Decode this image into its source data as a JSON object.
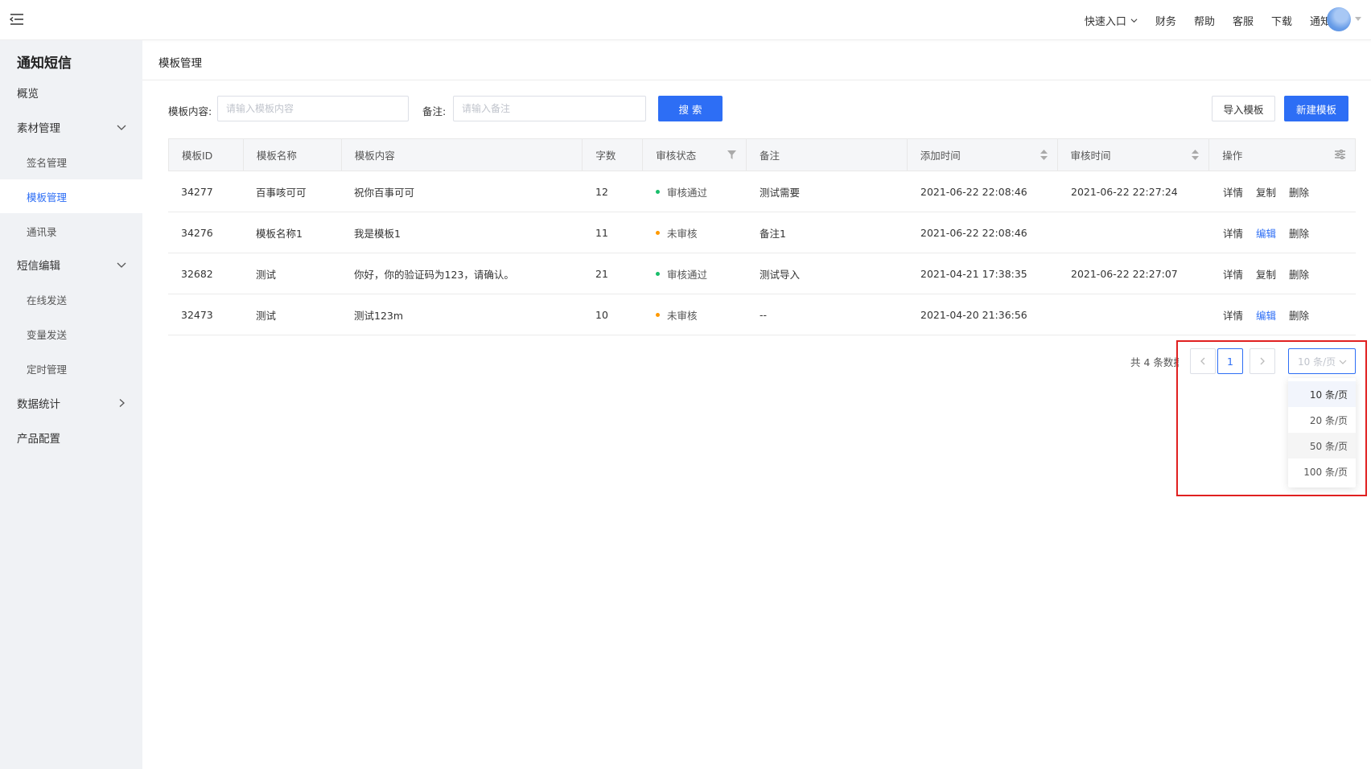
{
  "topnav": {
    "items": [
      {
        "label": "快速入口",
        "has_caret": true
      },
      {
        "label": "财务"
      },
      {
        "label": "帮助"
      },
      {
        "label": "客服"
      },
      {
        "label": "下载"
      },
      {
        "label": "通知"
      }
    ]
  },
  "sidebar": {
    "product_title": "通知短信",
    "items": [
      {
        "label": "概览",
        "level": 1
      },
      {
        "label": "素材管理",
        "level": 1,
        "arrow": "chevron-down"
      },
      {
        "label": "签名管理",
        "level": 2
      },
      {
        "label": "模板管理",
        "level": 2,
        "active": true
      },
      {
        "label": "通讯录",
        "level": 2
      },
      {
        "label": "短信编辑",
        "level": 1,
        "arrow": "chevron-down"
      },
      {
        "label": "在线发送",
        "level": 2
      },
      {
        "label": "变量发送",
        "level": 2
      },
      {
        "label": "定时管理",
        "level": 2
      },
      {
        "label": "数据统计",
        "level": 1,
        "arrow": "chevron-right"
      },
      {
        "label": "产品配置",
        "level": 1
      }
    ]
  },
  "page": {
    "breadcrumb": "模板管理"
  },
  "filters": {
    "content_label": "模板内容:",
    "content_placeholder": "请输入模板内容",
    "content_value": "",
    "remark_label": "备注:",
    "remark_placeholder": "请输入备注",
    "remark_value": "",
    "search_button": "搜 索",
    "import_button": "导入模板",
    "new_button": "新建模板"
  },
  "table": {
    "headers": [
      "模板ID",
      "模板名称",
      "模板内容",
      "字数",
      "审核状态",
      "备注",
      "添加时间",
      "审核时间",
      "操作"
    ],
    "rows": [
      {
        "id": "34277",
        "name": "百事咳可可",
        "content": "祝你百事可可",
        "count": "12",
        "status": "审核通过",
        "status_color": "#19be6b",
        "remark": "测试需要",
        "added": "2021-06-22 22:08:46",
        "reviewed": "2021-06-22 22:27:24",
        "ops": [
          "详情",
          "复制",
          "删除"
        ],
        "ops_link": [
          false,
          false,
          false
        ]
      },
      {
        "id": "34276",
        "name": "模板名称1",
        "content": "我是模板1",
        "count": "11",
        "status": "未审核",
        "status_color": "#ff9900",
        "remark": "备注1",
        "added": "2021-06-22 22:08:46",
        "reviewed": "",
        "ops": [
          "详情",
          "编辑",
          "删除"
        ],
        "ops_link": [
          false,
          true,
          false
        ]
      },
      {
        "id": "32682",
        "name": "测试",
        "content": "你好，你的验证码为123，请确认。",
        "count": "21",
        "status": "审核通过",
        "status_color": "#19be6b",
        "remark": "测试导入",
        "added": "2021-04-21 17:38:35",
        "reviewed": "2021-06-22 22:27:07",
        "ops": [
          "详情",
          "复制",
          "删除"
        ],
        "ops_link": [
          false,
          false,
          false
        ]
      },
      {
        "id": "32473",
        "name": "测试",
        "content": "测试123m",
        "count": "10",
        "status": "未审核",
        "status_color": "#ff9900",
        "remark": "--",
        "added": "2021-04-20 21:36:56",
        "reviewed": "",
        "ops": [
          "详情",
          "编辑",
          "删除"
        ],
        "ops_link": [
          false,
          true,
          false
        ]
      }
    ]
  },
  "pagination": {
    "total_text": "共 4 条数据",
    "current_page": "1",
    "page_size": "10 条/页",
    "size_options": [
      "10 条/页",
      "20 条/页",
      "50 条/页",
      "100 条/页"
    ]
  },
  "colors": {
    "primary": "#2d6ef5",
    "approved": "#19be6b",
    "pending": "#ff9900",
    "highlight": "#e02020"
  }
}
